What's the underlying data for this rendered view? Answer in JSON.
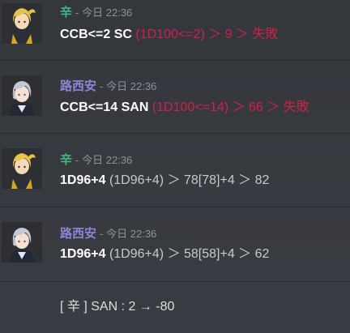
{
  "messages": [
    {
      "author": "辛",
      "sep": "-",
      "time": "今日 22:36",
      "text_main": "CCB<=2 SC",
      "text_detail": "(1D100<=2) ＞ 9 ＞ 失敗"
    },
    {
      "author": "路西安",
      "sep": "-",
      "time": "今日 22:36",
      "text_main": "CCB<=14 SAN",
      "text_detail": "(1D100<=14) ＞ 66 ＞ 失敗"
    },
    {
      "author": "辛",
      "sep": "-",
      "time": "今日 22:36",
      "text_main": "1D96+4",
      "text_paren": "(1D96+4)",
      "text_result": "＞ 78[78]+4 ＞ 82"
    },
    {
      "author": "路西安",
      "sep": "-",
      "time": "今日 22:36",
      "text_main": "1D96+4",
      "text_paren": "(1D96+4)",
      "text_result": "＞ 58[58]+4 ＞ 62"
    }
  ],
  "system_message": "[ 辛 ] SAN : 2 → -80",
  "colors": {
    "background": "#36393f",
    "name_xin": "#43b581",
    "name_lu": "#8d84d6",
    "fail": "#d0204b",
    "timestamp": "#8e9297"
  },
  "icons": {
    "avatar_xin": "blonde-character-avatar-icon",
    "avatar_lu": "silver-haired-character-avatar-icon"
  }
}
